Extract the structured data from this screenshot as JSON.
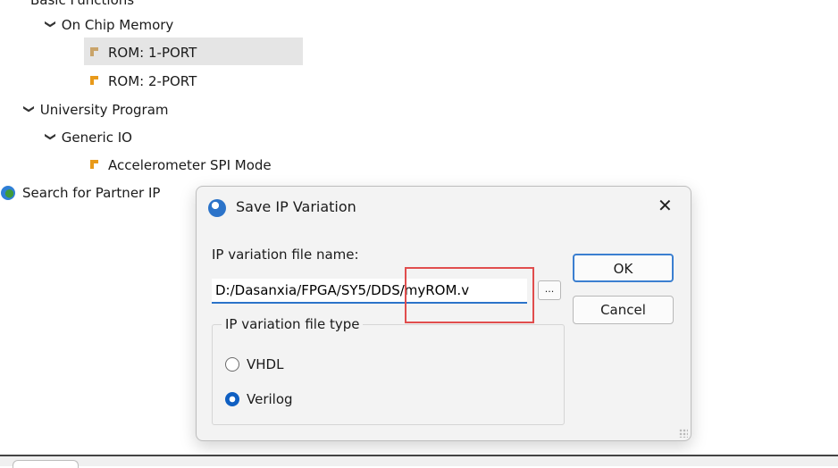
{
  "tree": {
    "basic_functions": "Basic Functions",
    "on_chip_memory": "On Chip Memory",
    "rom_1port": "ROM: 1-PORT",
    "rom_2port": "ROM: 2-PORT",
    "university_program": "University Program",
    "generic_io": "Generic IO",
    "accelerometer": "Accelerometer SPI Mode",
    "search_partner": "Search for Partner IP"
  },
  "dialog": {
    "title": "Save IP Variation",
    "close_glyph": "✕",
    "file_name_label": "IP variation file name:",
    "file_name_value": "D:/Dasanxia/FPGA/SY5/DDS/myROM.v",
    "browse_label": "...",
    "ok_label": "OK",
    "cancel_label": "Cancel",
    "file_type_legend": "IP variation file type",
    "options": [
      {
        "label": "VHDL",
        "selected": false
      },
      {
        "label": "Verilog",
        "selected": true
      }
    ]
  },
  "colors": {
    "accent": "#2b73c9",
    "highlight_box": "#e04d4d",
    "ip_icon": "#e89a1a"
  }
}
